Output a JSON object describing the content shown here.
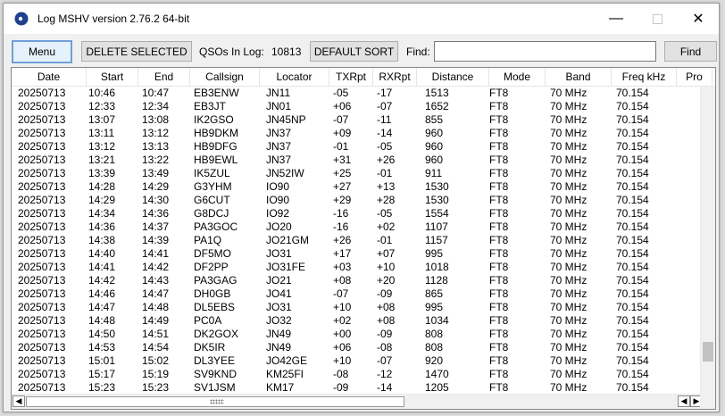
{
  "window": {
    "title": "Log MSHV version 2.76.2 64-bit"
  },
  "toolbar": {
    "menu_label": "Menu",
    "delete_label": "DELETE SELECTED",
    "qso_label": "QSOs In Log:",
    "qso_count": "10813",
    "sort_label": "DEFAULT SORT",
    "find_label": "Find:",
    "find_value": "",
    "find_button": "Find"
  },
  "table": {
    "columns": [
      "Date",
      "Start",
      "End",
      "Callsign",
      "Locator",
      "TXRpt",
      "RXRpt",
      "Distance",
      "Mode",
      "Band",
      "Freq kHz",
      "Pro"
    ],
    "rows": [
      [
        "20250713",
        "10:46",
        "10:47",
        "EB3ENW",
        "JN11",
        "-05",
        "-17",
        "1513",
        "FT8",
        "70 MHz",
        "70.154"
      ],
      [
        "20250713",
        "12:33",
        "12:34",
        "EB3JT",
        "JN01",
        "+06",
        "-07",
        "1652",
        "FT8",
        "70 MHz",
        "70.154"
      ],
      [
        "20250713",
        "13:07",
        "13:08",
        "IK2GSO",
        "JN45NP",
        "-07",
        "-11",
        "855",
        "FT8",
        "70 MHz",
        "70.154"
      ],
      [
        "20250713",
        "13:11",
        "13:12",
        "HB9DKM",
        "JN37",
        "+09",
        "-14",
        "960",
        "FT8",
        "70 MHz",
        "70.154"
      ],
      [
        "20250713",
        "13:12",
        "13:13",
        "HB9DFG",
        "JN37",
        "-01",
        "-05",
        "960",
        "FT8",
        "70 MHz",
        "70.154"
      ],
      [
        "20250713",
        "13:21",
        "13:22",
        "HB9EWL",
        "JN37",
        "+31",
        "+26",
        "960",
        "FT8",
        "70 MHz",
        "70.154"
      ],
      [
        "20250713",
        "13:39",
        "13:49",
        "IK5ZUL",
        "JN52IW",
        "+25",
        "-01",
        "911",
        "FT8",
        "70 MHz",
        "70.154"
      ],
      [
        "20250713",
        "14:28",
        "14:29",
        "G3YHM",
        "IO90",
        "+27",
        "+13",
        "1530",
        "FT8",
        "70 MHz",
        "70.154"
      ],
      [
        "20250713",
        "14:29",
        "14:30",
        "G6CUT",
        "IO90",
        "+29",
        "+28",
        "1530",
        "FT8",
        "70 MHz",
        "70.154"
      ],
      [
        "20250713",
        "14:34",
        "14:36",
        "G8DCJ",
        "IO92",
        "-16",
        "-05",
        "1554",
        "FT8",
        "70 MHz",
        "70.154"
      ],
      [
        "20250713",
        "14:36",
        "14:37",
        "PA3GOC",
        "JO20",
        "-16",
        "+02",
        "1107",
        "FT8",
        "70 MHz",
        "70.154"
      ],
      [
        "20250713",
        "14:38",
        "14:39",
        "PA1Q",
        "JO21GM",
        "+26",
        "-01",
        "1157",
        "FT8",
        "70 MHz",
        "70.154"
      ],
      [
        "20250713",
        "14:40",
        "14:41",
        "DF5MO",
        "JO31",
        "+17",
        "+07",
        "995",
        "FT8",
        "70 MHz",
        "70.154"
      ],
      [
        "20250713",
        "14:41",
        "14:42",
        "DF2PP",
        "JO31FE",
        "+03",
        "+10",
        "1018",
        "FT8",
        "70 MHz",
        "70.154"
      ],
      [
        "20250713",
        "14:42",
        "14:43",
        "PA3GAG",
        "JO21",
        "+08",
        "+20",
        "1128",
        "FT8",
        "70 MHz",
        "70.154"
      ],
      [
        "20250713",
        "14:46",
        "14:47",
        "DH0GB",
        "JO41",
        "-07",
        "-09",
        "865",
        "FT8",
        "70 MHz",
        "70.154"
      ],
      [
        "20250713",
        "14:47",
        "14:48",
        "DL5EBS",
        "JO31",
        "+10",
        "+08",
        "995",
        "FT8",
        "70 MHz",
        "70.154"
      ],
      [
        "20250713",
        "14:48",
        "14:49",
        "PC0A",
        "JO32",
        "+02",
        "+08",
        "1034",
        "FT8",
        "70 MHz",
        "70.154"
      ],
      [
        "20250713",
        "14:50",
        "14:51",
        "DK2GOX",
        "JN49",
        "+00",
        "-09",
        "808",
        "FT8",
        "70 MHz",
        "70.154"
      ],
      [
        "20250713",
        "14:53",
        "14:54",
        "DK5IR",
        "JN49",
        "+06",
        "-08",
        "808",
        "FT8",
        "70 MHz",
        "70.154"
      ],
      [
        "20250713",
        "15:01",
        "15:02",
        "DL3YEE",
        "JO42GE",
        "+10",
        "-07",
        "920",
        "FT8",
        "70 MHz",
        "70.154"
      ],
      [
        "20250713",
        "15:17",
        "15:19",
        "SV9KND",
        "KM25FI",
        "-08",
        "-12",
        "1470",
        "FT8",
        "70 MHz",
        "70.154"
      ],
      [
        "20250713",
        "15:23",
        "15:23",
        "SV1JSM",
        "KM17",
        "-09",
        "-14",
        "1205",
        "FT8",
        "70 MHz",
        "70.154"
      ]
    ]
  }
}
